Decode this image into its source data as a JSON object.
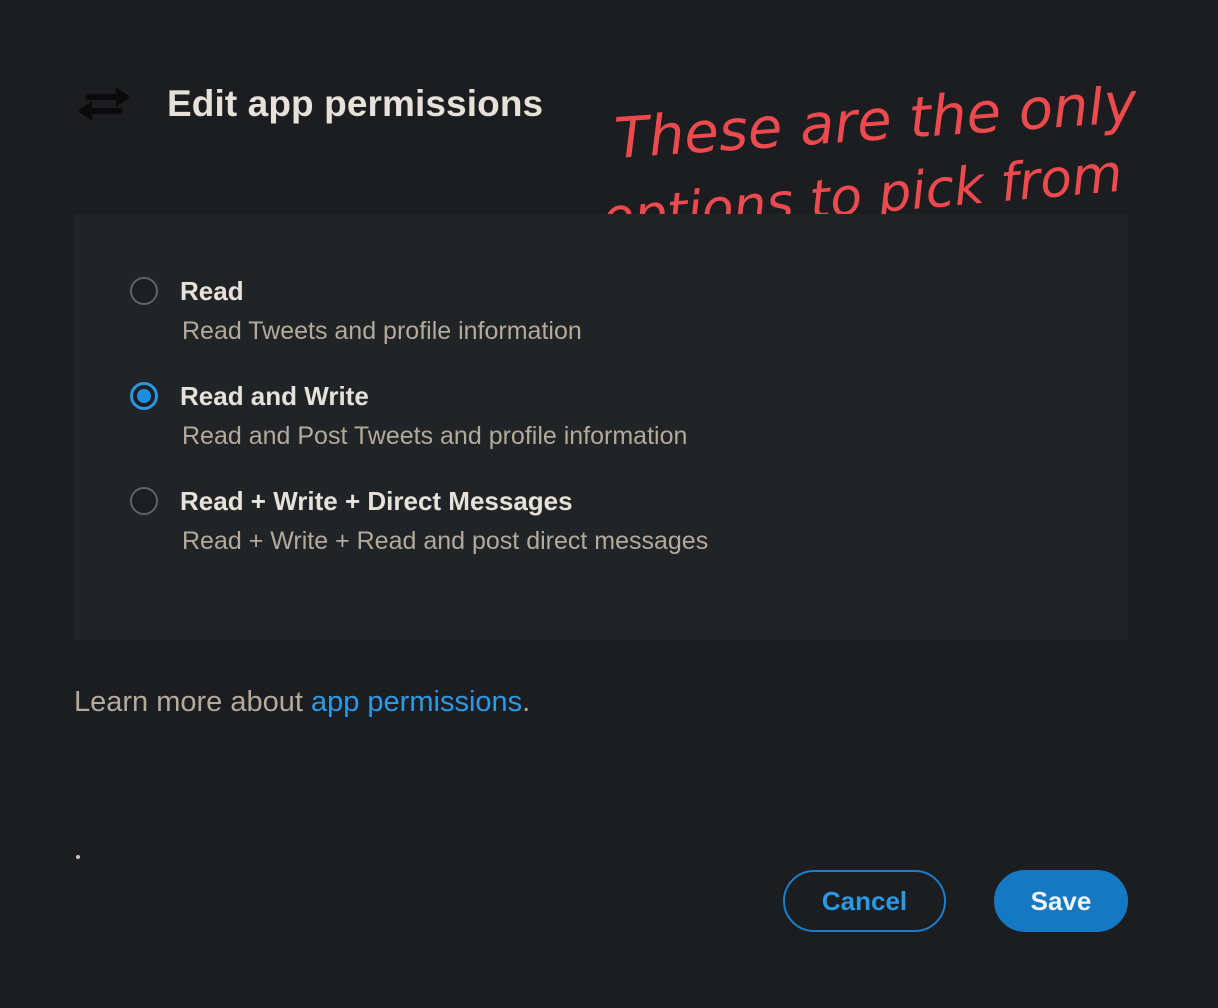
{
  "header": {
    "title": "Edit app permissions",
    "icon": "swap-arrows-icon"
  },
  "annotation": {
    "line1": "These are the only",
    "line2": "options to pick from",
    "color": "#ec4a4e"
  },
  "options": [
    {
      "label": "Read",
      "description": "Read Tweets and profile information",
      "checked": false
    },
    {
      "label": "Read and Write",
      "description": "Read and Post Tweets and profile information",
      "checked": true
    },
    {
      "label": "Read + Write + Direct Messages",
      "description": "Read + Write + Read and post direct messages",
      "checked": false
    }
  ],
  "learn_more": {
    "prefix": "Learn more about ",
    "link_text": "app permissions",
    "suffix": "."
  },
  "footer": {
    "stray_mark": "·"
  },
  "buttons": {
    "cancel": "Cancel",
    "save": "Save"
  },
  "colors": {
    "background": "#1b1d20",
    "panel": "#212427",
    "accent": "#1d8fe0",
    "link": "#2b9ae6",
    "save_button": "#1578c2"
  }
}
